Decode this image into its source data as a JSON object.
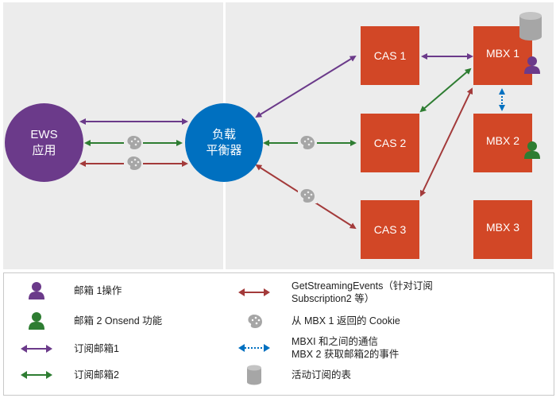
{
  "diagram": {
    "ews_node": {
      "line1": "EWS",
      "line2": "应用",
      "color": "#6b3a8a"
    },
    "load_balancer": {
      "line1": "负载",
      "line2": "平衡器",
      "color": "#0070c0"
    },
    "cas_nodes": [
      {
        "label": "CAS 1"
      },
      {
        "label": "CAS 2"
      },
      {
        "label": "CAS 3"
      }
    ],
    "mbx_nodes": [
      {
        "label": "MBX 1"
      },
      {
        "label": "MBX 2"
      },
      {
        "label": "MBX 3"
      }
    ],
    "server_color": "#d24726",
    "colors": {
      "purple": "#6b3a8a",
      "green": "#2e7d32",
      "red": "#a33a3a",
      "blue": "#0070c0",
      "gray": "#a6a6a6"
    }
  },
  "legend": {
    "items": [
      {
        "icon": "person-purple-icon",
        "text": "邮箱 1操作"
      },
      {
        "icon": "person-green-icon",
        "text": "邮箱 2 Onsend 功能"
      },
      {
        "icon": "purple-arrow-icon",
        "text": "订阅邮箱1"
      },
      {
        "icon": "green-arrow-icon",
        "text": "订阅邮箱2"
      },
      {
        "icon": "red-arrow-icon",
        "text": "GetStreamingEvents（针对订阅",
        "text2": "Subscription2 等）"
      },
      {
        "icon": "cookie-icon",
        "text": "从 MBX 1 返回的 Cookie"
      },
      {
        "icon": "blue-dotted-arrow-icon",
        "text": "MBXI 和之间的通信",
        "text2": "MBX 2 获取邮箱2的事件"
      },
      {
        "icon": "database-icon",
        "text": "活动订阅的表"
      }
    ]
  }
}
